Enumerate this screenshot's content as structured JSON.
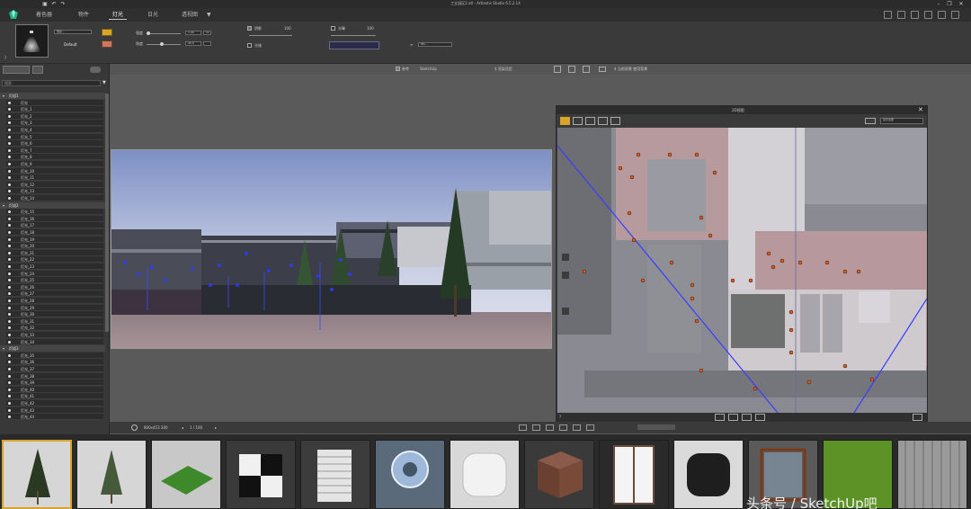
{
  "window": {
    "title": "工业园区2.atl - Artlantis Studio 6.5.2.14",
    "controls": [
      "minimize",
      "maximize",
      "close"
    ]
  },
  "menu": {
    "tabs": [
      {
        "label": "着色器",
        "active": false
      },
      {
        "label": "物件",
        "active": false
      },
      {
        "label": "灯光",
        "active": true
      },
      {
        "label": "日光",
        "active": false
      },
      {
        "label": "透视图",
        "active": false
      }
    ],
    "dropdown_arrow": "▼"
  },
  "ribbon": {
    "light_name": "Default",
    "color_field": "色彩...",
    "power_label": "强度",
    "power_value": "1.00",
    "angle_label": "角度",
    "angle_value": "45.0",
    "unit_value": "lm",
    "sun_check": "阴影",
    "sun_value": "100",
    "cone_check": "光锥",
    "glow_check": "光晕",
    "glow_value": "100",
    "preset_field": "IES..."
  },
  "left_panel": {
    "search_placeholder": "搜索",
    "groups": [
      {
        "name": "灯组1",
        "items": [
          "灯光",
          "灯光_1",
          "灯光_2",
          "灯光_3",
          "灯光_4",
          "灯光_5",
          "灯光_6",
          "灯光_7",
          "灯光_8",
          "灯光_9",
          "灯光_10",
          "灯光_11",
          "灯光_12",
          "灯光_13",
          "灯光_14"
        ]
      },
      {
        "name": "灯组2",
        "items": [
          "灯光_15",
          "灯光_16",
          "灯光_17",
          "灯光_18",
          "灯光_19",
          "灯光_20",
          "灯光_21",
          "灯光_22",
          "灯光_23",
          "灯光_24",
          "灯光_25",
          "灯光_26",
          "灯光_27",
          "灯光_28",
          "灯光_29",
          "灯光_30",
          "灯光_31",
          "灯光_32",
          "灯光_33",
          "灯光_34"
        ]
      },
      {
        "name": "灯组3",
        "items": [
          "灯光_35",
          "灯光_36",
          "灯光_37",
          "灯光_38",
          "灯光_39",
          "灯光_40",
          "灯光_41",
          "灯光_42",
          "灯光_43",
          "灯光_44"
        ]
      }
    ]
  },
  "viewport": {
    "toolbar_check": "参考",
    "toolbar_label": "SketchUp",
    "toolbar_label2": "$ 渲染设定",
    "toolbar_label3": "$ 当前背景 使用背景",
    "resolution": "800x453 300",
    "page": "1 / 100"
  },
  "view2d": {
    "title": "2D视图",
    "view_option": "显示全部"
  },
  "library": {
    "items": [
      {
        "name": "tree-1",
        "selected": true
      },
      {
        "name": "tree-2",
        "selected": false
      },
      {
        "name": "grass-patch",
        "selected": false
      },
      {
        "name": "checker-cube",
        "selected": false
      },
      {
        "name": "louver-panel",
        "selected": false
      },
      {
        "name": "material-sphere",
        "selected": false
      },
      {
        "name": "white-cushion",
        "selected": false
      },
      {
        "name": "wood-cube",
        "selected": false
      },
      {
        "name": "door-frame",
        "selected": false
      },
      {
        "name": "black-cushion",
        "selected": false
      },
      {
        "name": "window-frame",
        "selected": false
      },
      {
        "name": "lawn-texture",
        "selected": false
      },
      {
        "name": "grey-panel",
        "selected": false
      }
    ],
    "watermark": "头条号 / SketchUp吧"
  },
  "colors": {
    "accent": "#d9a429",
    "panel_dark": "#2c2c2c",
    "light_marker": "#e05a1e"
  }
}
